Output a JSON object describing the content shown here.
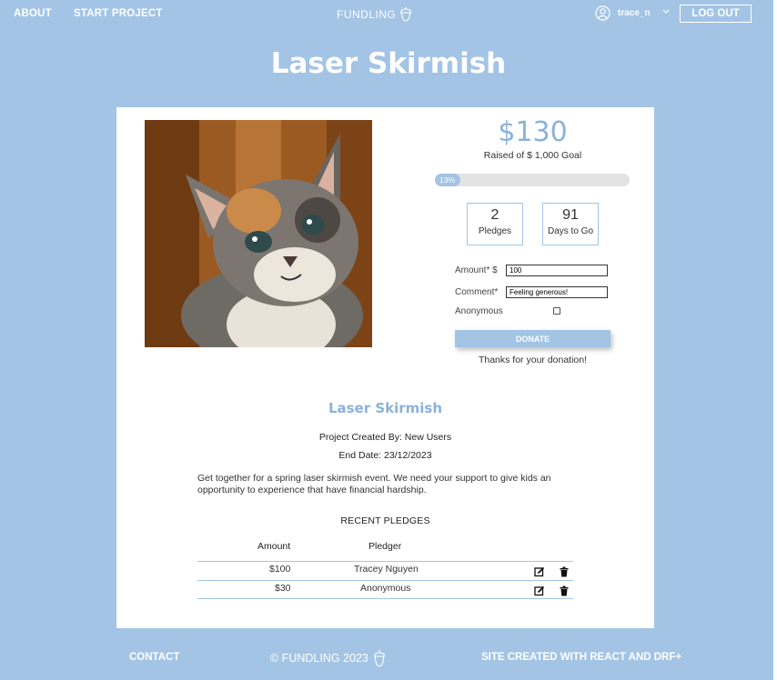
{
  "nav": {
    "about": "ABOUT",
    "start_project": "START PROJECT",
    "brand": "FUNDLING",
    "username": "trace_n",
    "logout": "LOG OUT"
  },
  "project": {
    "title": "Laser Skirmish",
    "image_alt": "kitten photo",
    "amount_raised": "$130",
    "raised_of_goal": "Raised of $ 1,000 Goal",
    "progress_percent": 13,
    "progress_label": "13%",
    "pledges_count": "2",
    "pledges_label": "Pledges",
    "days_count": "91",
    "days_label": "Days to Go",
    "subtitle": "Laser Skirmish",
    "created_by": "Project Created By: New Users",
    "end_date": "End Date: 23/12/2023",
    "description": "Get together for a spring laser skirmish event. We need your support to give kids an opportunity to experience that have financial hardship."
  },
  "form": {
    "amount_label": "Amount* $",
    "amount_value": "100",
    "comment_label": "Comment*",
    "comment_value": "Feeling generous!",
    "anonymous_label": "Anonymous",
    "anonymous_checked": false,
    "donate": "DONATE",
    "thanks": "Thanks for your donation!"
  },
  "pledges": {
    "heading": "RECENT PLEDGES",
    "columns": [
      "Amount",
      "Pledger"
    ],
    "rows": [
      {
        "amount": "$100",
        "pledger": "Tracey Nguyen"
      },
      {
        "amount": "$30",
        "pledger": "Anonymous"
      }
    ]
  },
  "footer": {
    "contact": "CONTACT",
    "copyright": "© FUNDLING 2023",
    "credit": "SITE CREATED WITH REACT AND DRF+"
  },
  "colors": {
    "background": "#a3c4e4",
    "accent_text": "#8bb2da",
    "card": "#ffffff"
  }
}
